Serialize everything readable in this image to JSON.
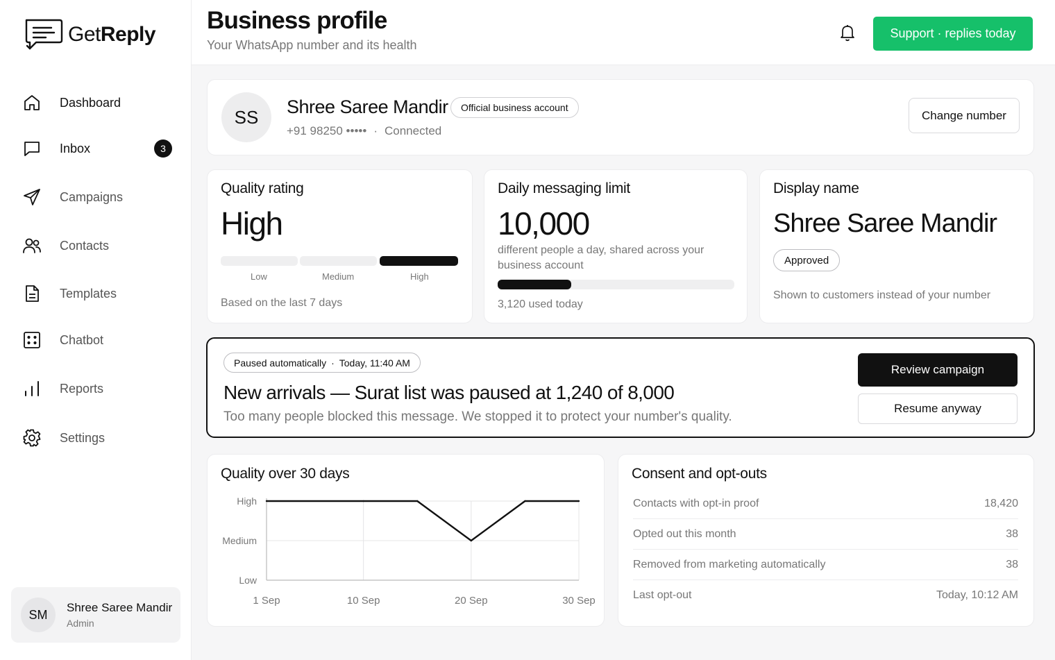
{
  "brand": {
    "name_light": "Get",
    "name_bold": "Reply"
  },
  "nav": [
    {
      "label": "Dashboard",
      "icon": "home-icon"
    },
    {
      "label": "Inbox",
      "icon": "chat-icon",
      "badge": "3"
    },
    {
      "label": "Campaigns",
      "icon": "send-icon"
    },
    {
      "label": "Contacts",
      "icon": "users-icon"
    },
    {
      "label": "Templates",
      "icon": "document-icon"
    },
    {
      "label": "Chatbot",
      "icon": "bot-icon"
    },
    {
      "label": "Reports",
      "icon": "bar-chart-icon"
    },
    {
      "label": "Settings",
      "icon": "gear-icon"
    }
  ],
  "user": {
    "initials": "SM",
    "name": "Shree Saree Mandir",
    "role": "Admin"
  },
  "header": {
    "title": "Business profile",
    "subtitle": "Your WhatsApp number and its health",
    "support_label": "Support · replies today"
  },
  "profile": {
    "initials": "SS",
    "name": "Shree Saree Mandir",
    "badge": "Official business account",
    "phone": "+91 98250 •••••",
    "separator": "·",
    "status": "Connected",
    "change_label": "Change number"
  },
  "quality": {
    "title": "Quality rating",
    "value": "High",
    "levels": [
      "Low",
      "Medium",
      "High"
    ],
    "active_level": 2,
    "footnote": "Based on the last 7 days"
  },
  "limit": {
    "title": "Daily messaging limit",
    "value": "10,000",
    "description": "different people a day, shared across your business account",
    "used_fraction": 0.312,
    "used_label": "3,120 used today"
  },
  "display_name": {
    "title": "Display name",
    "value": "Shree Saree Mandir",
    "status": "Approved",
    "note": "Shown to customers instead of your number"
  },
  "alert": {
    "chip_status": "Paused automatically",
    "chip_sep": "·",
    "chip_time": "Today, 11:40 AM",
    "headline": "New arrivals — Surat list was paused at 1,240 of 8,000",
    "description": "Too many people blocked this message. We stopped it to protect your number's quality.",
    "primary_label": "Review campaign",
    "secondary_label": "Resume anyway"
  },
  "chart_data": {
    "type": "line",
    "title": "Quality over 30 days",
    "x": [
      "1 Sep",
      "10 Sep",
      "15 Sep",
      "20 Sep",
      "25 Sep",
      "30 Sep"
    ],
    "x_days": [
      1,
      10,
      15,
      20,
      25,
      30
    ],
    "x_ticks": [
      "1 Sep",
      "10 Sep",
      "20 Sep",
      "30 Sep"
    ],
    "x_tick_days": [
      1,
      10,
      20,
      30
    ],
    "y_levels": [
      "Low",
      "Medium",
      "High"
    ],
    "series": [
      {
        "values": [
          "High",
          "High",
          "High",
          "Medium",
          "High",
          "High"
        ]
      }
    ],
    "xlim": [
      1,
      30
    ],
    "grid": true
  },
  "consent": {
    "title": "Consent and opt-outs",
    "rows": [
      {
        "label": "Contacts with opt-in proof",
        "value": "18,420"
      },
      {
        "label": "Opted out this month",
        "value": "38"
      },
      {
        "label": "Removed from marketing automatically",
        "value": "38"
      },
      {
        "label": "Last opt-out",
        "value": "Today, 10:12 AM"
      }
    ]
  },
  "colors": {
    "accent": "#16c06a",
    "ink": "#111111",
    "muted": "#777777",
    "border": "#ececee"
  }
}
